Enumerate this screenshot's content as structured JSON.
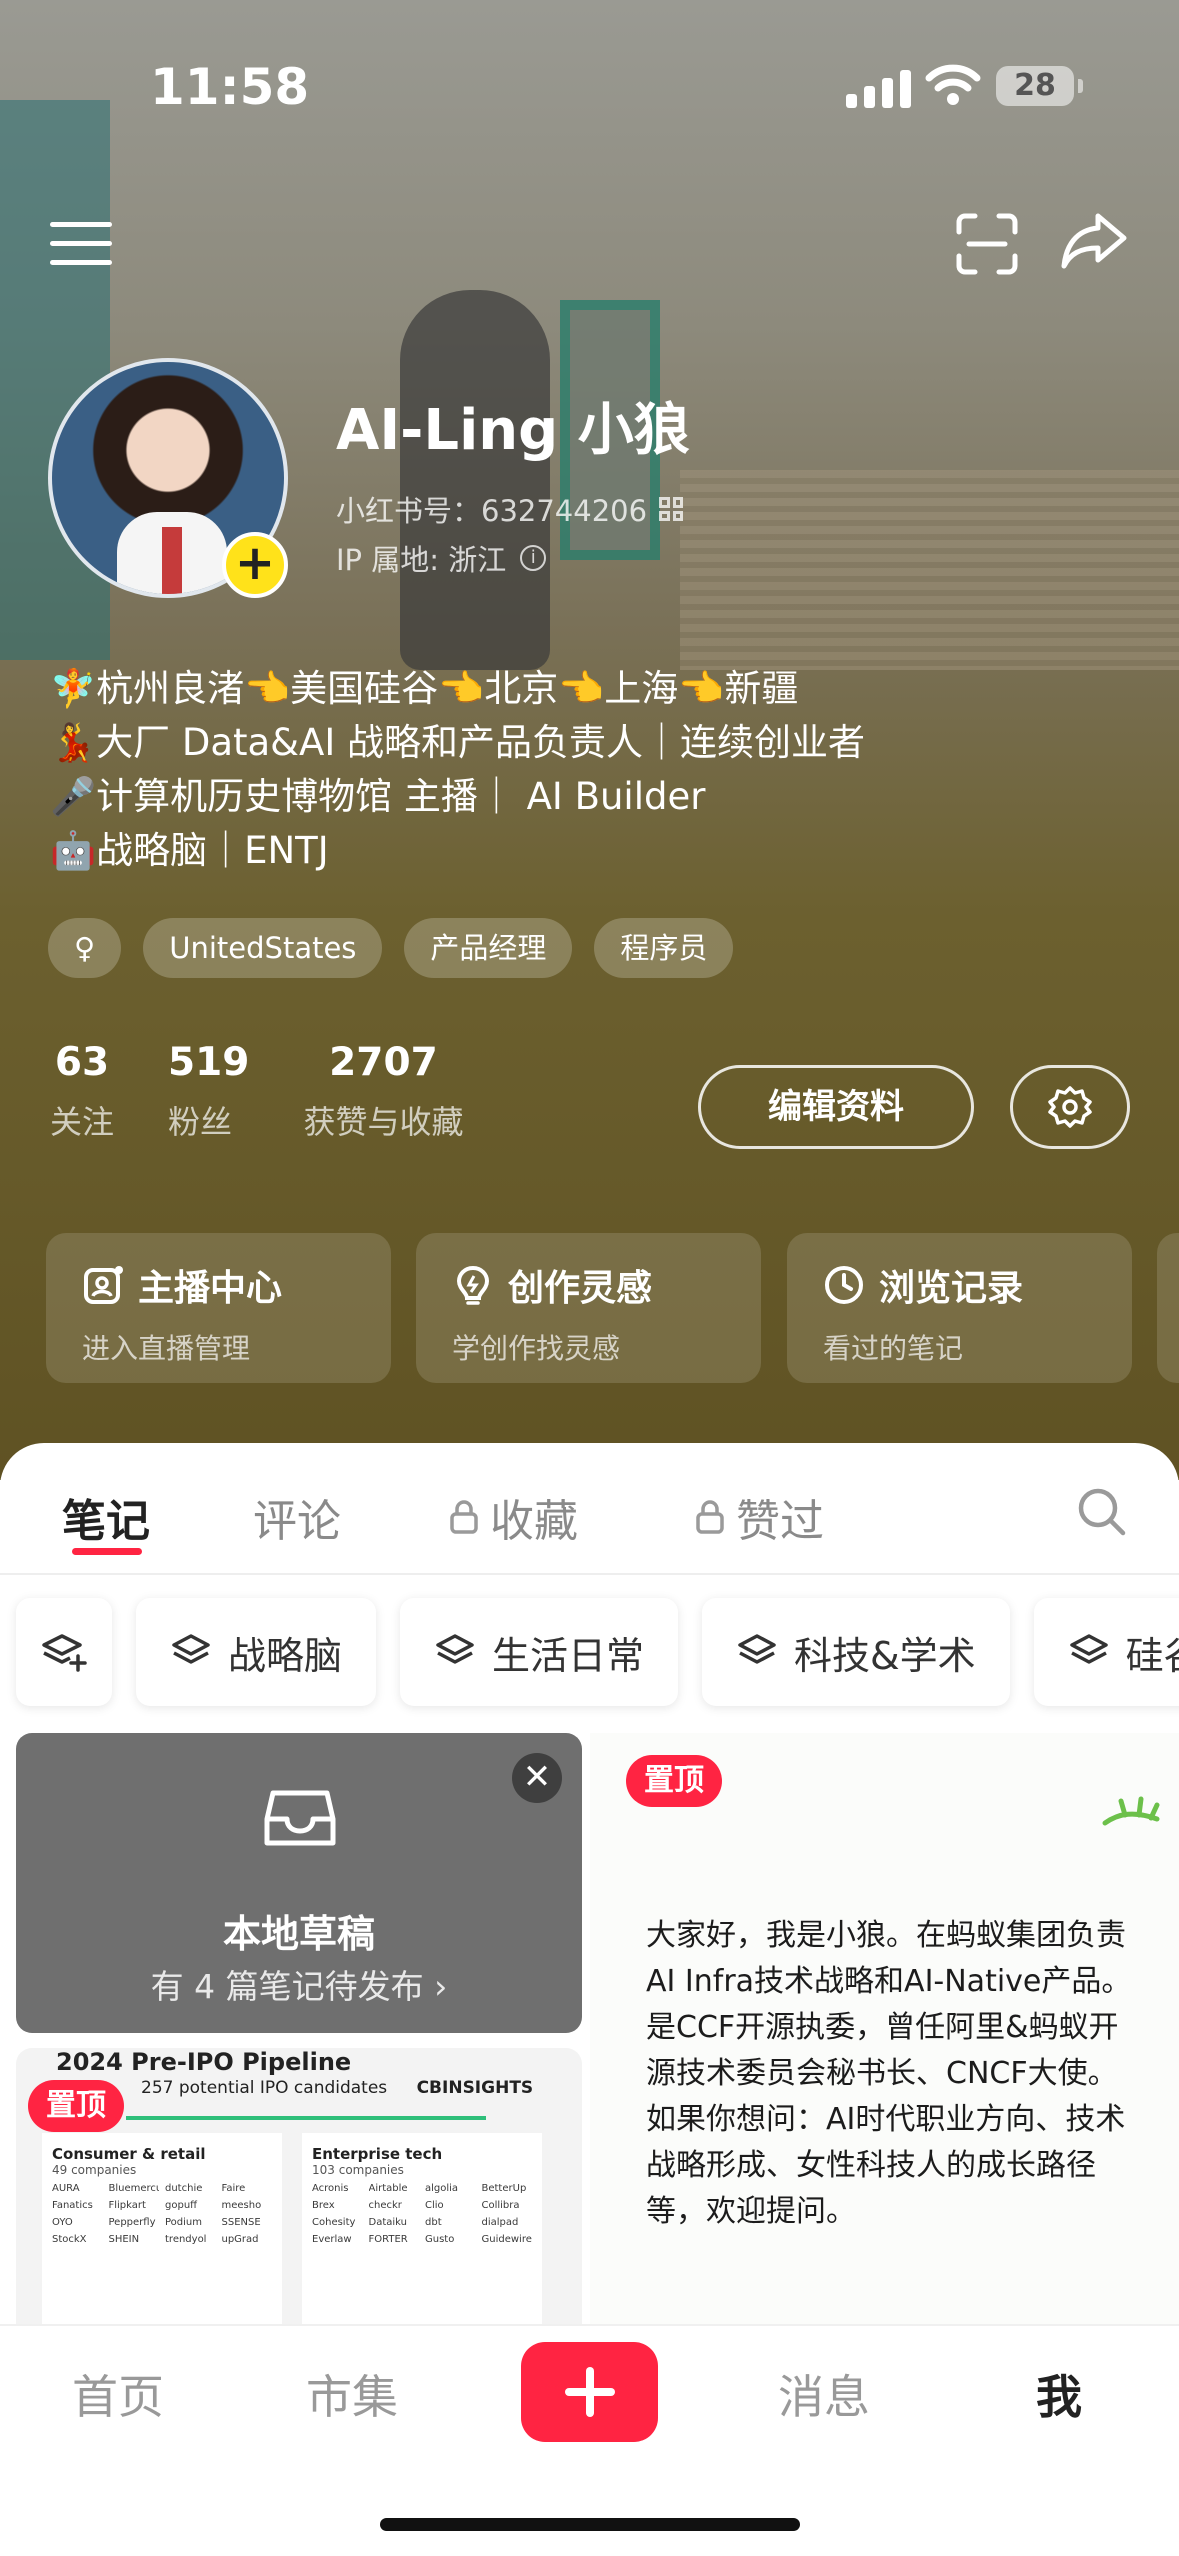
{
  "status_bar": {
    "time": "11:58",
    "battery": "28"
  },
  "profile": {
    "name": "AI-Ling 小狼",
    "id_line": "小红书号：632744206",
    "ip_line": "IP 属地: 浙江",
    "bio": [
      "🧚杭州良渚👈美国硅谷👈北京👈上海👈新疆",
      "💃大厂 Data&AI 战略和产品负责人｜连续创业者",
      "🎤计算机历史博物馆 主播｜ AI Builder",
      "🤖战略脑｜ENTJ"
    ],
    "tags": [
      "♀",
      "UnitedStates",
      "产品经理",
      "程序员"
    ],
    "stats": [
      {
        "num": "63",
        "label": "关注"
      },
      {
        "num": "519",
        "label": "粉丝"
      },
      {
        "num": "2707",
        "label": "获赞与收藏"
      }
    ],
    "edit_label": "编辑资料"
  },
  "quick_links": [
    {
      "title": "主播中心",
      "sub": "进入直播管理",
      "icon": "live-icon"
    },
    {
      "title": "创作灵感",
      "sub": "学创作找灵感",
      "icon": "lightbulb-icon"
    },
    {
      "title": "浏览记录",
      "sub": "看过的笔记",
      "icon": "clock-icon"
    }
  ],
  "tabs": [
    "笔记",
    "评论",
    "收藏",
    "赞过"
  ],
  "albums": [
    "战略脑",
    "生活日常",
    "科技&学术",
    "硅谷"
  ],
  "draft": {
    "title": "本地草稿",
    "sub": "有 4 篇笔记待发布 ›",
    "close": "✕"
  },
  "pin_label": "置顶",
  "note_left": {
    "title": "2024 Pre-IPO Pipeline",
    "subtitle": "257 potential IPO candidates",
    "source": "CBINSIGHTS",
    "panels": [
      {
        "title": "Consumer & retail",
        "count": "49 companies",
        "logos": [
          "AURA",
          "Bluemercury",
          "dutchie",
          "Faire",
          "Fanatics",
          "Flipkart",
          "gopuff",
          "meesho",
          "OYO",
          "Pepperfly",
          "Podium",
          "SSENSE",
          "StockX",
          "SHEIN",
          "trendyol",
          "upGrad"
        ]
      },
      {
        "title": "Enterprise tech",
        "count": "103 companies",
        "logos": [
          "Acronis",
          "Airtable",
          "algolia",
          "BetterUp",
          "Brex",
          "checkr",
          "Clio",
          "Collibra",
          "Cohesity",
          "Dataiku",
          "dbt",
          "dialpad",
          "Everlaw",
          "FORTER",
          "Gusto",
          "Guidewire"
        ]
      }
    ]
  },
  "note_right_text": "大家好，我是小狼。在蚂蚁集团负责AI Infra技术战略和AI-Native产品。是CCF开源执委，曾任阿里&蚂蚁开源技术委员会秘书长、CNCF大使。如果你想问：AI时代职业方向、技术战略形成、女性科技人的成长路径等，欢迎提问。",
  "bottom_nav": [
    "首页",
    "市集",
    "消息",
    "我"
  ],
  "colors": {
    "accent": "#ff2442",
    "avatar_badge": "#ffe21a"
  }
}
